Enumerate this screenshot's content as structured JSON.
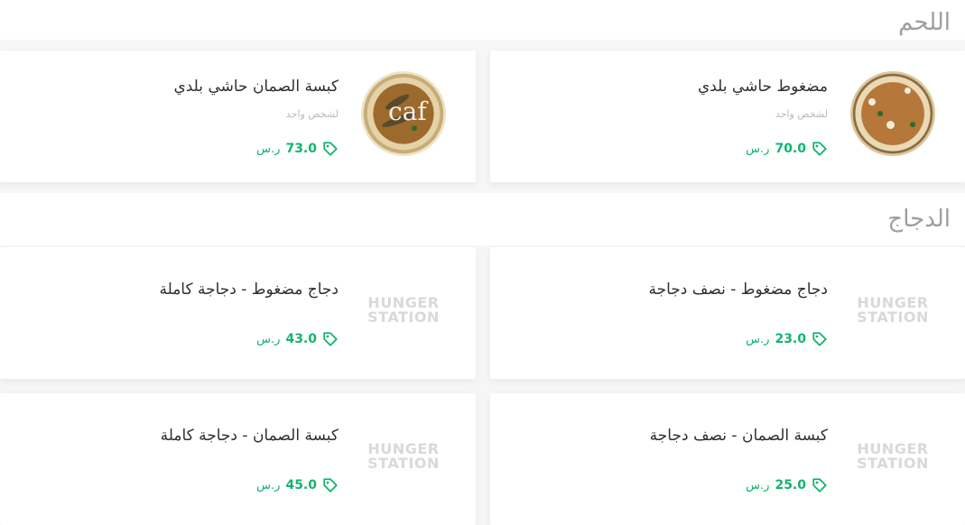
{
  "sections": [
    {
      "title": "اللحم",
      "items": [
        {
          "name": "مضغوط حاشي بلدي",
          "desc": "لشخص واحد",
          "price": "70.0",
          "currency": "ر.س",
          "image": "dish-photo"
        },
        {
          "name": "كبسة الصمان حاشي بلدي",
          "desc": "لشخص واحد",
          "price": "73.0",
          "currency": "ر.س",
          "image": "dish-photo-caf"
        }
      ]
    },
    {
      "title": "الدجاج",
      "items": [
        {
          "name": "دجاج مضغوط - نصف دجاجة",
          "price": "23.0",
          "currency": "ر.س",
          "image": "hungerstation-logo"
        },
        {
          "name": "دجاج مضغوط - دجاجة كاملة",
          "price": "43.0",
          "currency": "ر.س",
          "image": "hungerstation-logo"
        },
        {
          "name": "كبسة الصمان - نصف دجاجة",
          "price": "25.0",
          "currency": "ر.س",
          "image": "hungerstation-logo"
        },
        {
          "name": "كبسة الصمان - دجاجة كاملة",
          "price": "45.0",
          "currency": "ر.س",
          "image": "hungerstation-logo"
        }
      ]
    }
  ],
  "logo_text": {
    "line1": "HUNGER",
    "line2": "STATION"
  },
  "caf_text": "caf",
  "colors": {
    "price": "#11b46f",
    "title": "#9e9e9e",
    "name": "#2f2f2f"
  },
  "icons": {
    "price_tag": "tag-icon"
  }
}
